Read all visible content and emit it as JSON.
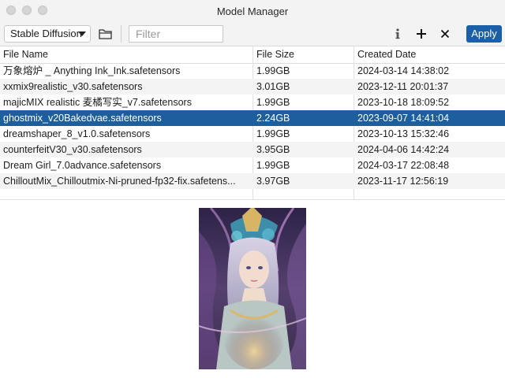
{
  "window": {
    "title": "Model Manager"
  },
  "toolbar": {
    "model_type": "Stable Diffusion",
    "filter_placeholder": "Filter",
    "filter_value": "",
    "apply_label": "Apply",
    "icons": [
      "folder-icon",
      "info-icon",
      "plus-icon",
      "close-icon"
    ]
  },
  "table": {
    "columns": [
      "File Name",
      "File Size",
      "Created Date"
    ],
    "rows": [
      {
        "name": "万象熔炉 _ Anything Ink_Ink.safetensors",
        "size": "1.99GB",
        "date": "2024-03-14 14:38:02"
      },
      {
        "name": "xxmix9realistic_v30.safetensors",
        "size": "3.01GB",
        "date": "2023-12-11 20:01:37"
      },
      {
        "name": "majicMIX realistic 麦橘写实_v7.safetensors",
        "size": "1.99GB",
        "date": "2023-10-18 18:09:52"
      },
      {
        "name": "ghostmix_v20Bakedvae.safetensors",
        "size": "2.24GB",
        "date": "2023-09-07 14:41:04"
      },
      {
        "name": "dreamshaper_8_v1.0.safetensors",
        "size": "1.99GB",
        "date": "2023-10-13 15:32:46"
      },
      {
        "name": "counterfeitV30_v30.safetensors",
        "size": "3.95GB",
        "date": "2024-04-06 14:42:24"
      },
      {
        "name": "Dream Girl_7.0advance.safetensors",
        "size": "1.99GB",
        "date": "2024-03-17 22:08:48"
      },
      {
        "name": "ChilloutMix_Chilloutmix-Ni-pruned-fp32-fix.safetens...",
        "size": "3.97GB",
        "date": "2023-11-17 12:56:19"
      }
    ],
    "selected_index": 3
  },
  "colors": {
    "accent": "#1b5fa6",
    "selected_row": "#1d5f9c"
  }
}
